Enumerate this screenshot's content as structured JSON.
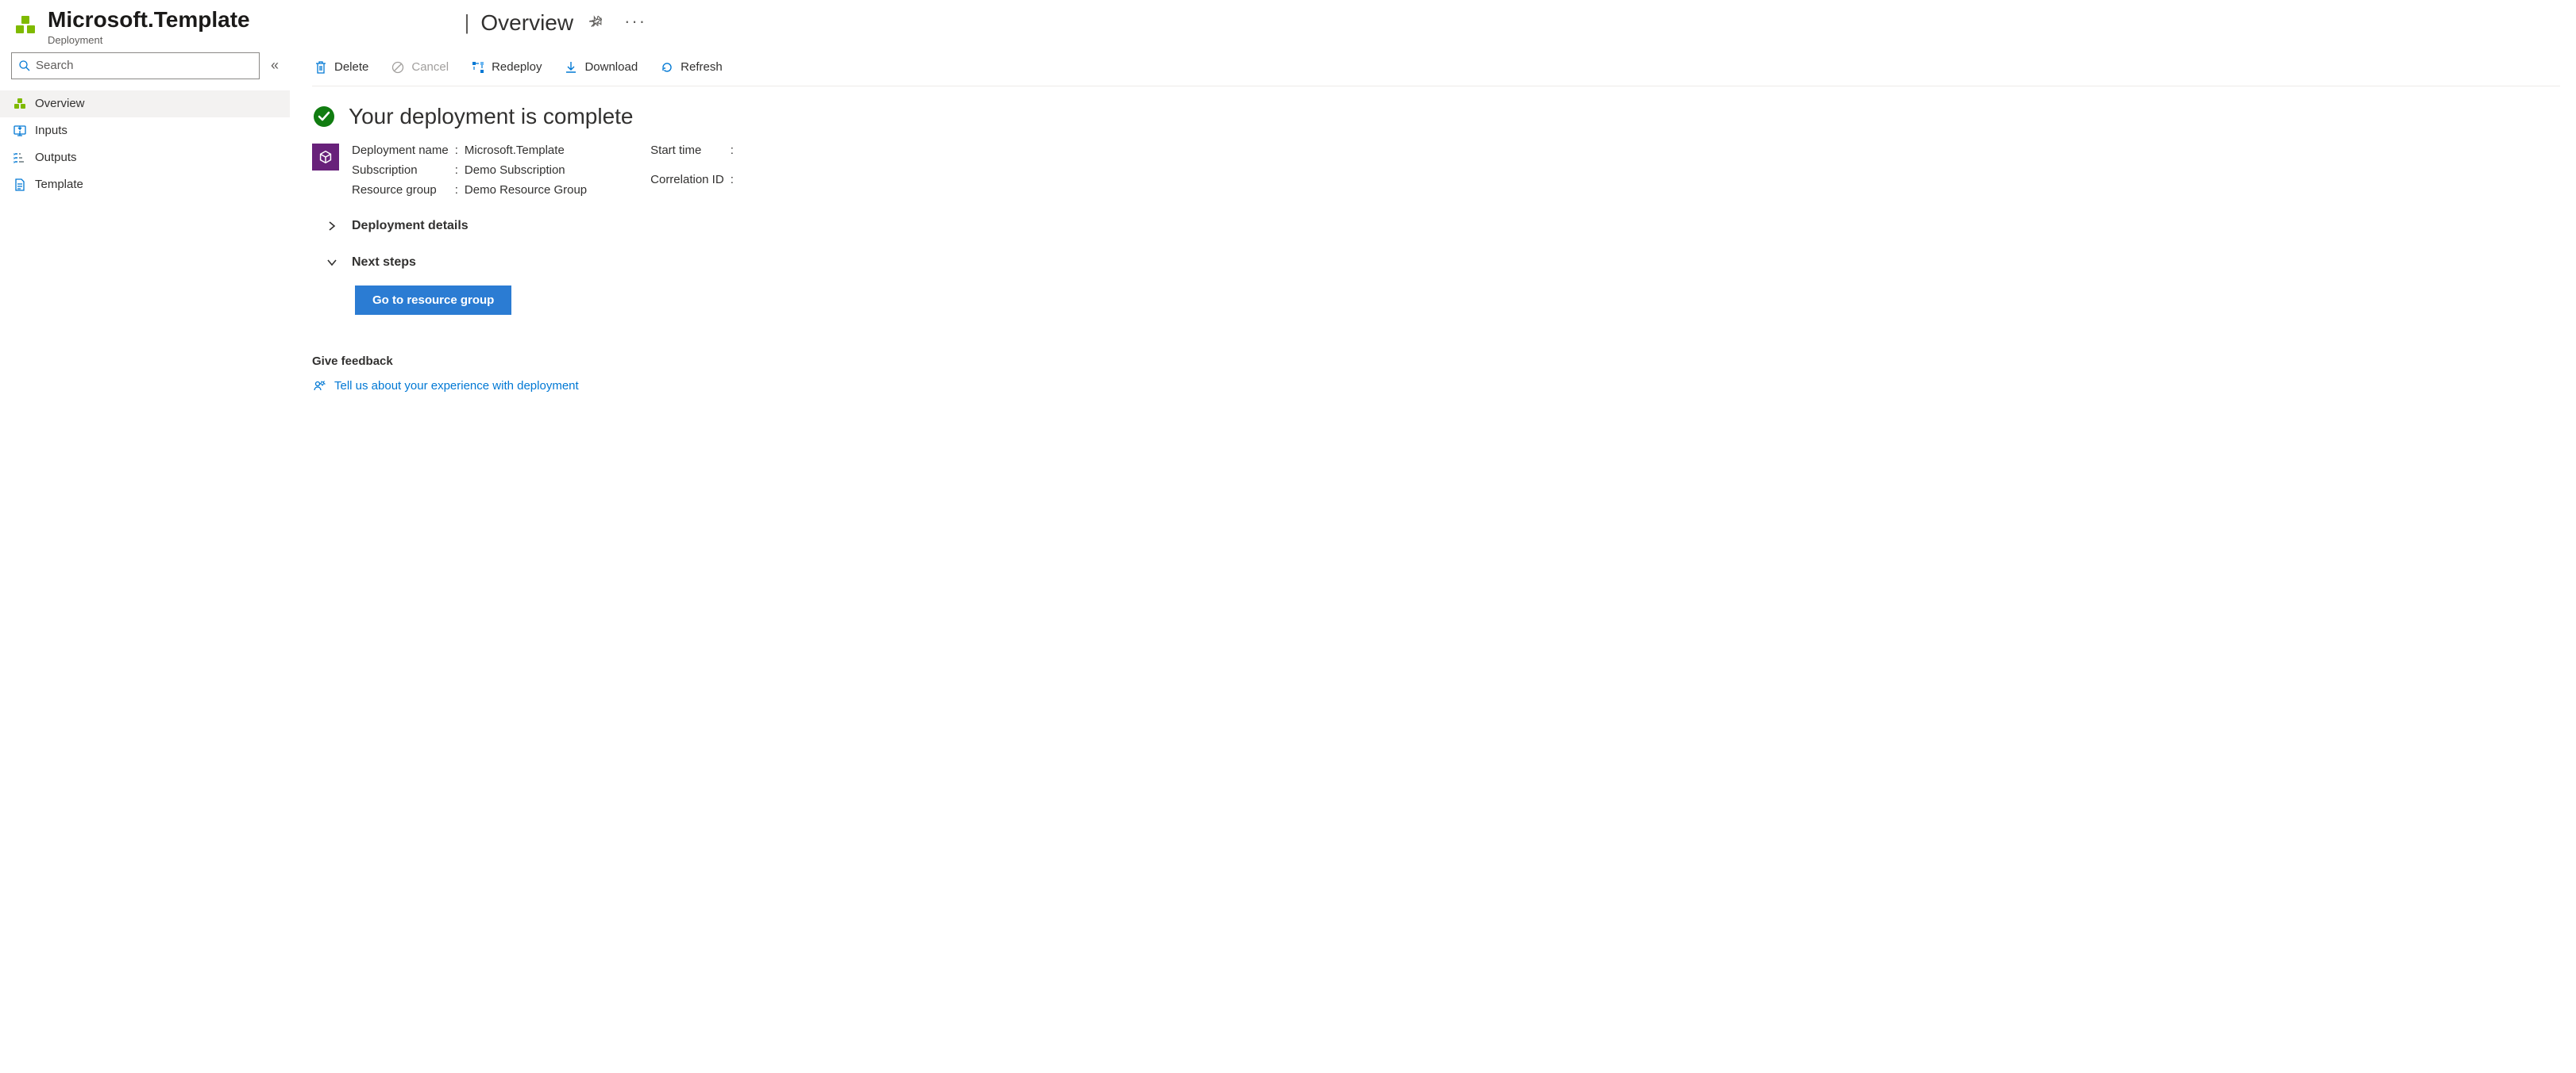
{
  "header": {
    "title": "Microsoft.Template",
    "subtitle": "Deployment",
    "breadcrumb_current": "Overview"
  },
  "sidebar": {
    "search_placeholder": "Search",
    "items": [
      {
        "label": "Overview"
      },
      {
        "label": "Inputs"
      },
      {
        "label": "Outputs"
      },
      {
        "label": "Template"
      }
    ]
  },
  "toolbar": {
    "delete": "Delete",
    "cancel": "Cancel",
    "redeploy": "Redeploy",
    "download": "Download",
    "refresh": "Refresh"
  },
  "status": {
    "title": "Your deployment is complete"
  },
  "details": {
    "left": {
      "deployment_name_label": "Deployment name",
      "deployment_name_value": "Microsoft.Template",
      "subscription_label": "Subscription",
      "subscription_value": "Demo Subscription",
      "resource_group_label": "Resource group",
      "resource_group_value": "Demo Resource Group"
    },
    "right": {
      "start_time_label": "Start time",
      "start_time_value": "",
      "correlation_id_label": "Correlation ID",
      "correlation_id_value": ""
    }
  },
  "expanders": {
    "deployment_details": "Deployment details",
    "next_steps": "Next steps"
  },
  "actions": {
    "go_to_resource_group": "Go to resource group"
  },
  "feedback": {
    "title": "Give feedback",
    "link": "Tell us about your experience with deployment"
  }
}
